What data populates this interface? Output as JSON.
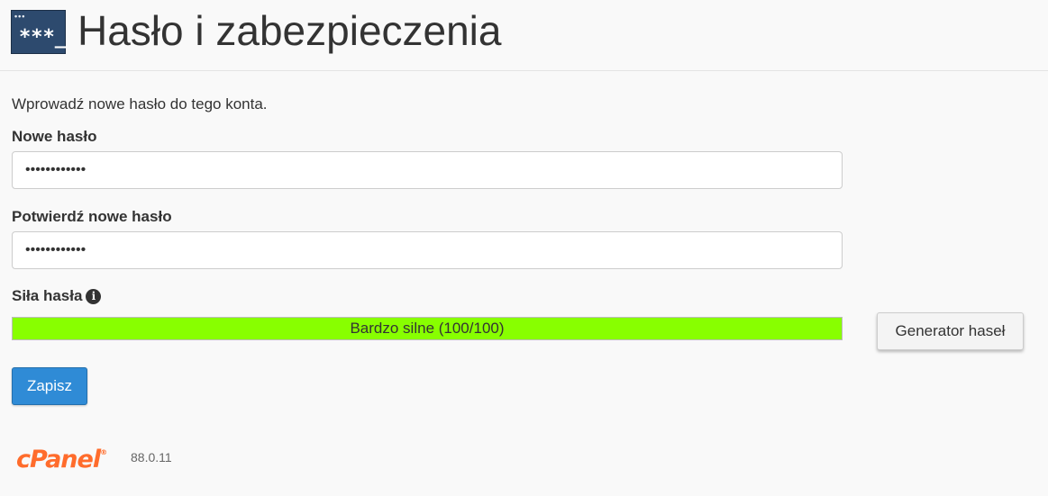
{
  "header": {
    "icon": "password-terminal-icon",
    "icon_dots": "•••",
    "icon_text": "***_",
    "title": "Hasło i zabezpieczenia"
  },
  "form": {
    "intro": "Wprowadź nowe hasło do tego konta.",
    "new_password": {
      "label": "Nowe hasło",
      "value": "••••••••••••"
    },
    "confirm_password": {
      "label": "Potwierdź nowe hasło",
      "value": "••••••••••••"
    },
    "strength": {
      "label": "Siła hasła",
      "info_icon": "i",
      "text": "Bardzo silne (100/100)",
      "score": 100,
      "max": 100,
      "fill_color": "#88ff00"
    },
    "generator_label": "Generator haseł",
    "save_label": "Zapisz"
  },
  "footer": {
    "brand": "cPanel",
    "registered": "®",
    "version": "88.0.11",
    "brand_color": "#ff6c2c"
  },
  "colors": {
    "primary_button": "#2f8bd6",
    "header_icon_bg": "#2d4a6e"
  }
}
